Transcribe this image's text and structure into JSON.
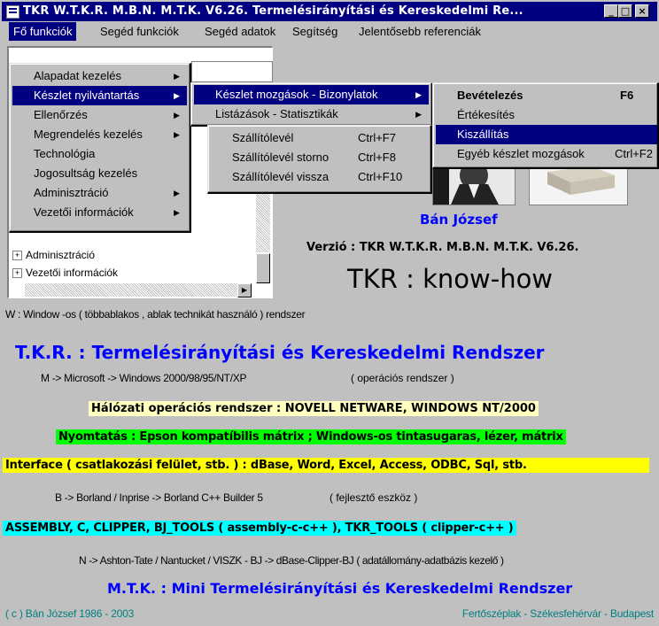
{
  "window": {
    "title": "TKR W.T.K.R. M.B.N. M.T.K. V6.26. Termelésirányítási és Kereskedelmi Re...",
    "minimize_label": "_",
    "maximize_label": "□",
    "close_label": "×"
  },
  "menubar": {
    "items": [
      {
        "label": "Fő funkciók"
      },
      {
        "label": "Segéd funkciók"
      },
      {
        "label": "Segéd adatok"
      },
      {
        "label": "Segítség"
      },
      {
        "label": "Jelentősebb referenciák"
      }
    ]
  },
  "main_menu": {
    "items": [
      {
        "label": "Alapadat kezelés",
        "arrow": "▶"
      },
      {
        "label": "Készlet nyilvántartás",
        "arrow": "▶"
      },
      {
        "label": "Ellenőrzés",
        "arrow": "▶"
      },
      {
        "label": "Megrendelés kezelés",
        "arrow": "▶"
      },
      {
        "label": "Technológia",
        "arrow": ""
      },
      {
        "label": "Jogosultság kezelés",
        "arrow": ""
      },
      {
        "label": "Adminisztráció",
        "arrow": "▶"
      },
      {
        "label": "Vezetői információk",
        "arrow": "▶"
      }
    ]
  },
  "stock_submenu": {
    "items": [
      {
        "label": "Készlet mozgások - Bizonylatok",
        "arrow": "▶"
      },
      {
        "label": "Listázások - Statisztikák",
        "arrow": "▶"
      }
    ]
  },
  "movements_submenu": {
    "items": [
      {
        "label": "Bevételezés",
        "shortcut": "F6"
      },
      {
        "label": "Értékesítés",
        "shortcut": ""
      },
      {
        "label": "Kiszállítás",
        "shortcut": ""
      },
      {
        "label": "Egyéb készlet mozgások",
        "shortcut": "Ctrl+F2"
      }
    ]
  },
  "delivery_submenu": {
    "items": [
      {
        "label": "Szállítólevél",
        "shortcut": "Ctrl+F7"
      },
      {
        "label": "Szállítólevél storno",
        "shortcut": "Ctrl+F8"
      },
      {
        "label": "Szállítólevél vissza",
        "shortcut": "Ctrl+F10"
      }
    ]
  },
  "tree": {
    "items": [
      {
        "label": "Adminisztráció"
      },
      {
        "label": "Vezetői információk"
      }
    ],
    "expand_glyph": "+"
  },
  "content": {
    "author": "Bán József",
    "version": "Verzió : TKR W.T.K.R. M.B.N. M.T.K. V6.26.",
    "slogan": "TKR :  know-how",
    "w_line": "W : Window -os ( többablakos , ablak technikát használó ) rendszer",
    "tkr_heading": "T.K.R. : Termelésirányítási és Kereskedelmi Rendszer",
    "m_line": "M -> Microsoft -> Windows 2000/98/95/NT/XP",
    "m_note": "( operációs rendszer )",
    "network": "Hálózati operációs rendszer : NOVELL NETWARE, WINDOWS NT/2000",
    "printing": "Nyomtatás : Epson kompatíbilis mátrix ;  Windows-os tintasugaras, lézer, mátrix",
    "interface": "Interface ( csatlakozási felület, stb. )  : dBase, Word, Excel, Access, ODBC, Sql, stb.",
    "b_line": "B -> Borland / Inprise -> Borland C++ Builder 5",
    "b_note": "( fejlesztő eszköz )",
    "assembly": "ASSEMBLY, C, CLIPPER, BJ_TOOLS ( assembly-c-c++ ), TKR_TOOLS ( clipper-c++ )",
    "n_line": "N -> Ashton-Tate / Nantucket / VISZK - BJ -> dBase-Clipper-BJ   ( adatállomány-adatbázis kezelő )",
    "mtk_heading": "M.T.K.  : Mini Termelésirányítási és Kereskedelmi Rendszer",
    "copyright": "( c ) Bán József 1986 - 2003",
    "locations": "Fertőszéplak - Székesfehérvár - Budapest"
  },
  "colors": {
    "window_bg": "#c0c0c0",
    "title_bar": "#000080",
    "highlight": "#000080",
    "heading_blue": "#0000ff",
    "network_bg": "#ffffc0",
    "printing_bg": "#00ff00",
    "interface_bg": "#ffff00",
    "assembly_bg": "#00ffff",
    "footer_teal": "#008080"
  }
}
